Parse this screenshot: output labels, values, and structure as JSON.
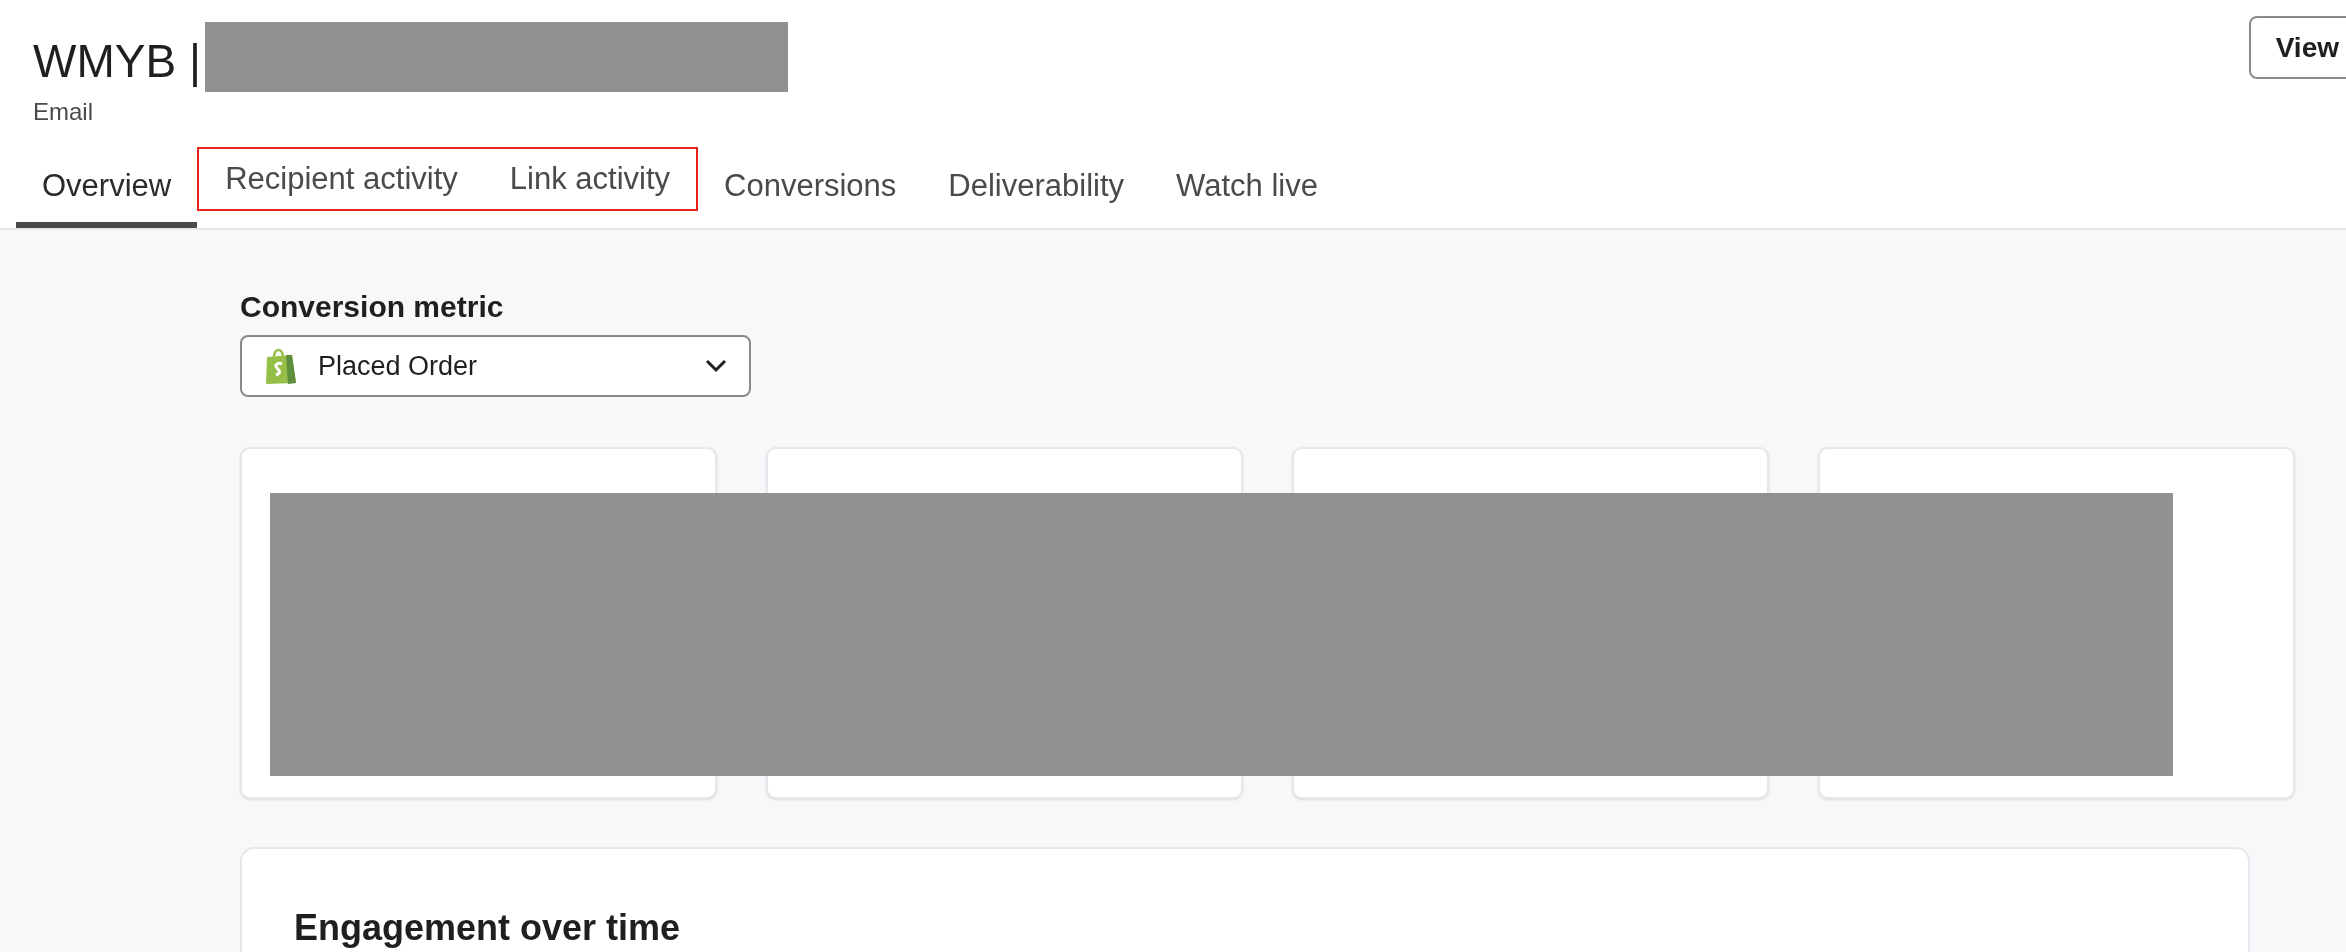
{
  "header": {
    "title": "WMYB |",
    "subtitle": "Email",
    "view_button": "View"
  },
  "tabs": [
    {
      "label": "Overview",
      "selected": true,
      "highlighted": false
    },
    {
      "label": "Recipient activity",
      "selected": false,
      "highlighted": true
    },
    {
      "label": "Link activity",
      "selected": false,
      "highlighted": true
    },
    {
      "label": "Conversions",
      "selected": false,
      "highlighted": false
    },
    {
      "label": "Deliverability",
      "selected": false,
      "highlighted": false
    },
    {
      "label": "Watch live",
      "selected": false,
      "highlighted": false
    }
  ],
  "conversion_metric": {
    "label": "Conversion metric",
    "value": "Placed Order"
  },
  "engagement": {
    "title": "Engagement over time"
  }
}
